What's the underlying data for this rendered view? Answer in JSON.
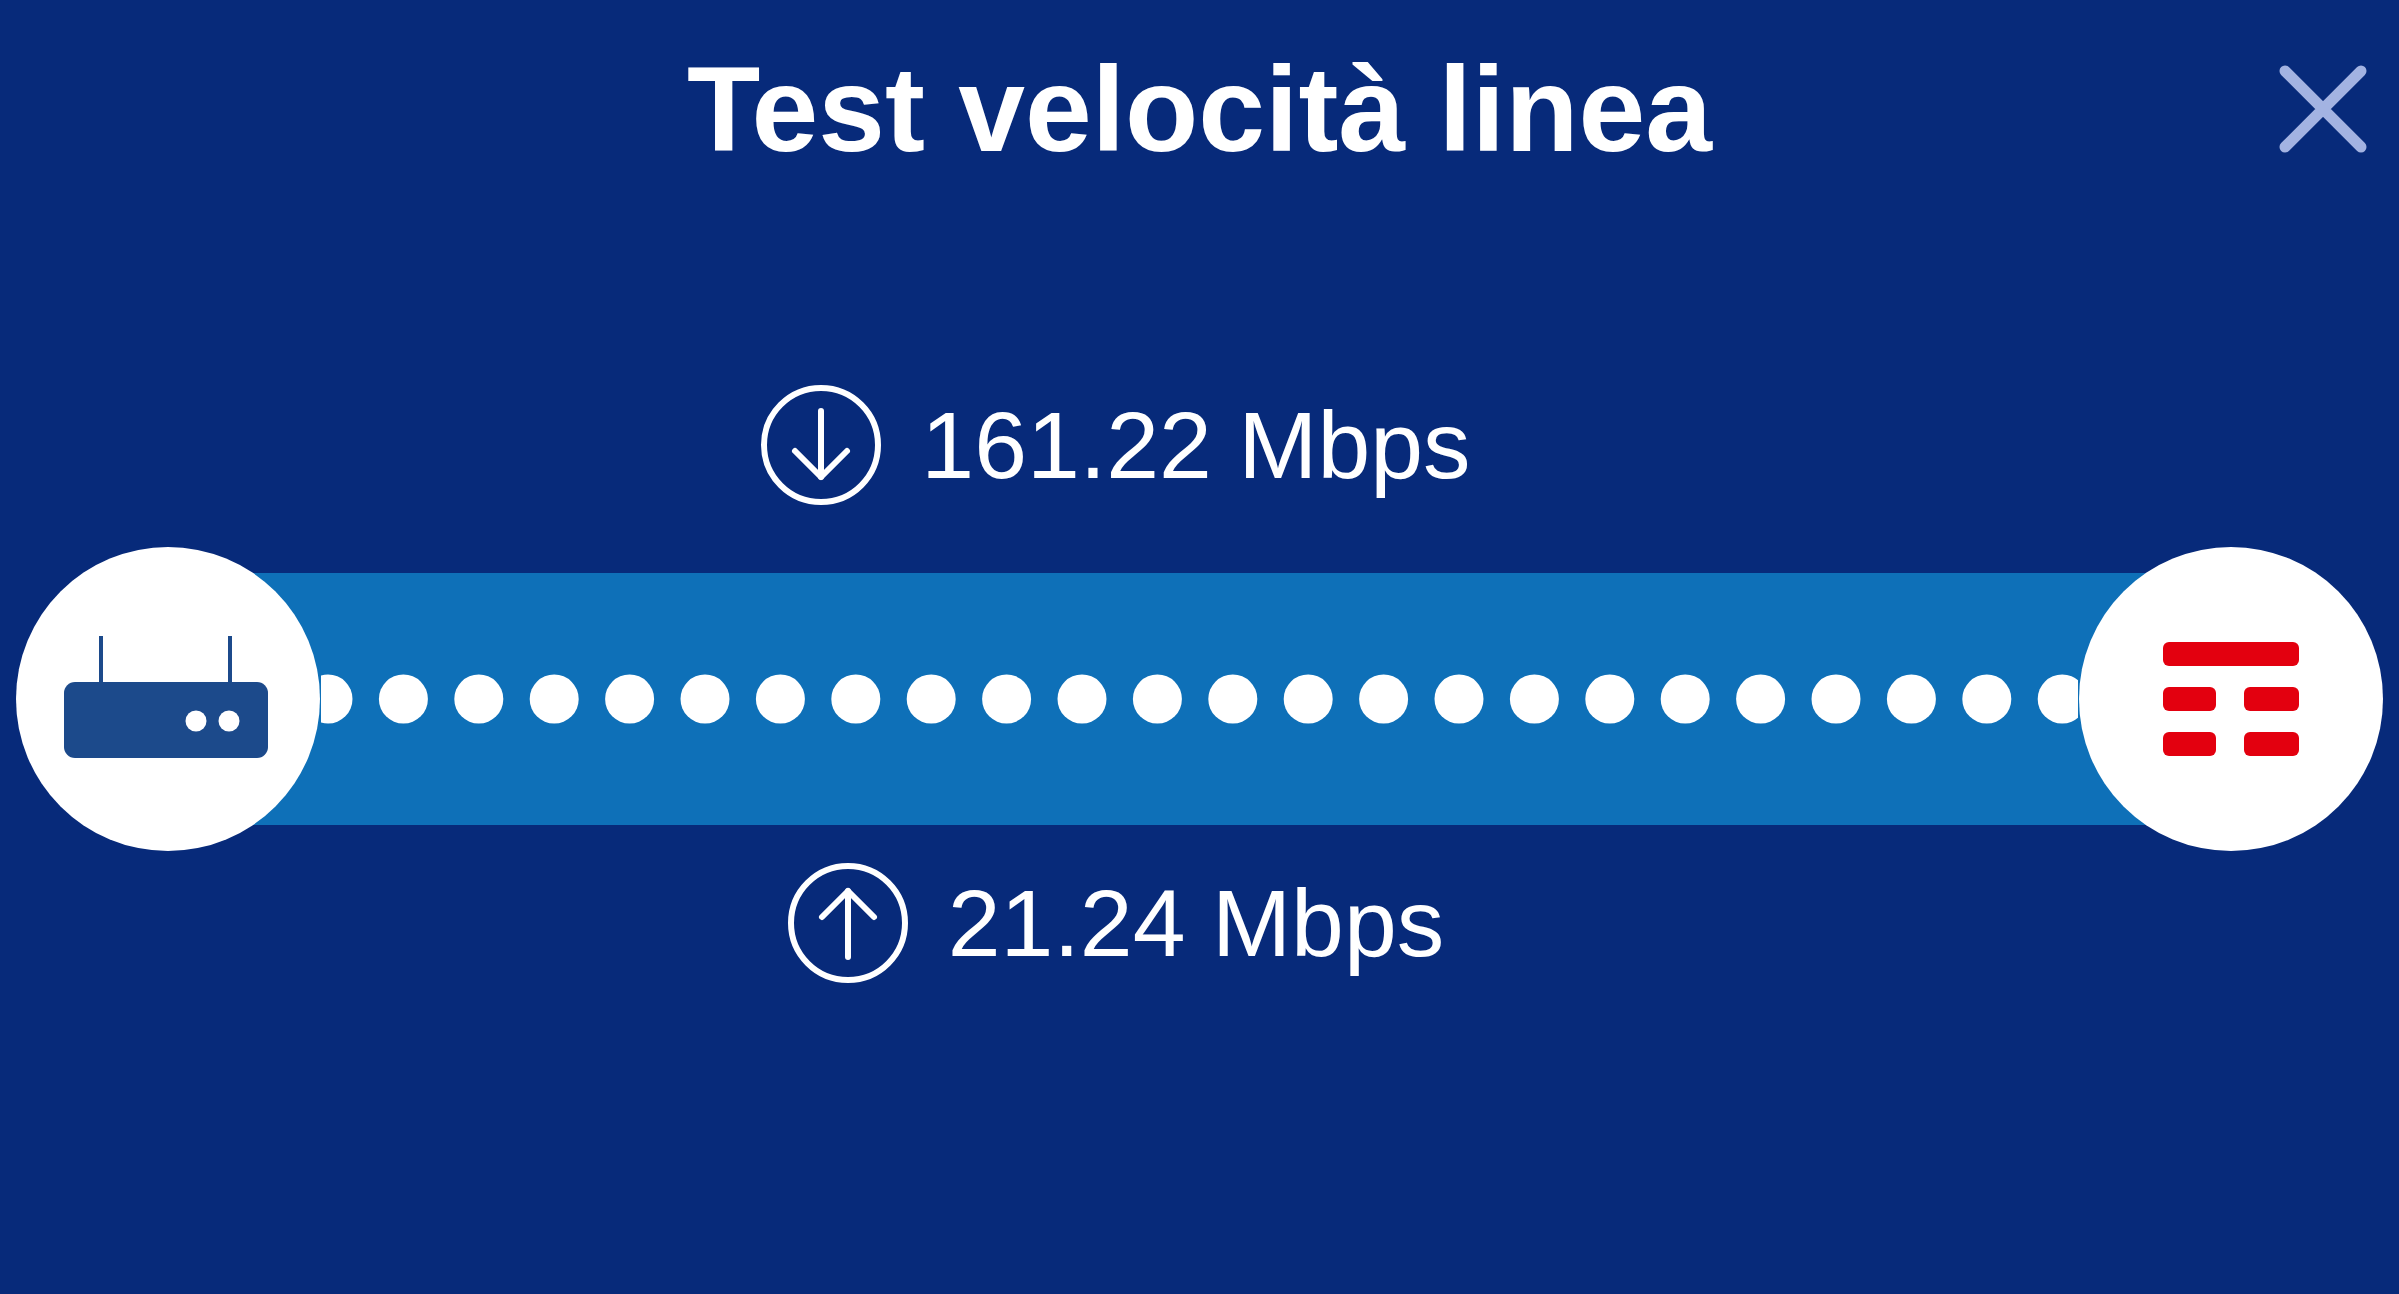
{
  "header": {
    "title": "Test velocità linea"
  },
  "speeds": [
    {
      "kind": "download",
      "value": "161.22 Mbps"
    },
    {
      "kind": "upload",
      "value": "21.24 Mbps"
    }
  ]
}
